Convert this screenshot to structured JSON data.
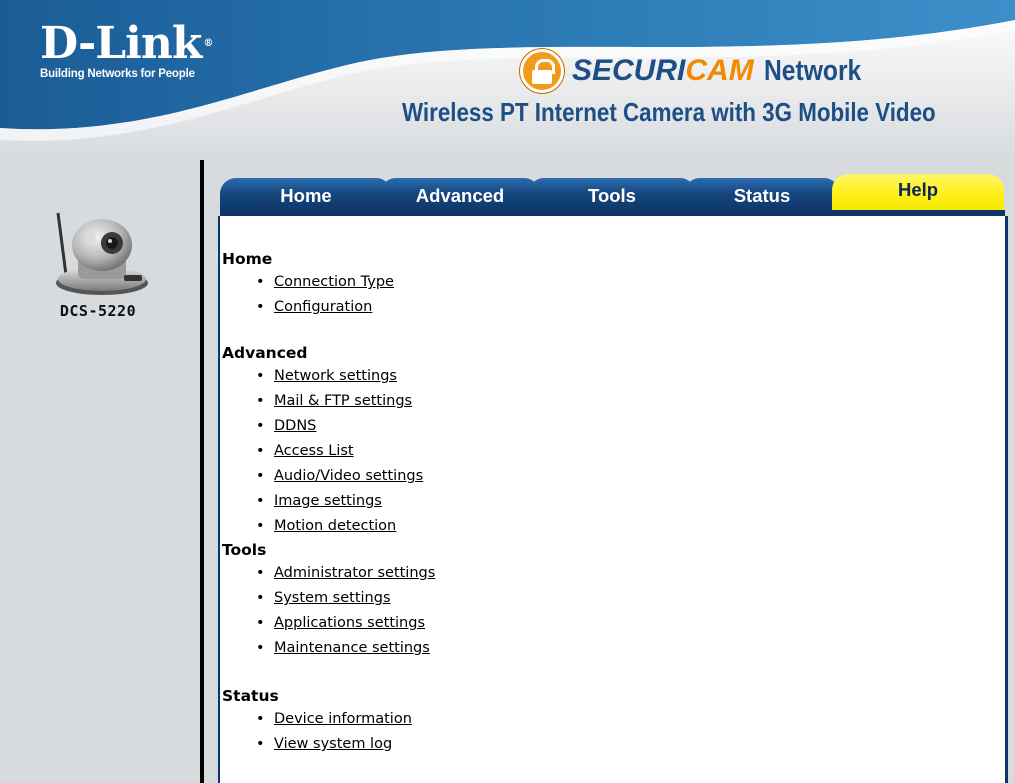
{
  "header": {
    "brand_logo": "D-Link",
    "brand_tagline": "Building Networks for People",
    "securicam_prefix": "SECURI",
    "securicam_suffix": "CAM",
    "securicam_network": "Network",
    "product_title": "Wireless PT Internet Camera with 3G Mobile Video",
    "colors": {
      "header_blue": "#1d4f86",
      "accent_orange": "#f18a00"
    }
  },
  "sidebar": {
    "model": "DCS-5220",
    "camera_icon": "camera-icon"
  },
  "tabs": [
    {
      "label": "Home",
      "active": false
    },
    {
      "label": "Advanced",
      "active": false
    },
    {
      "label": "Tools",
      "active": false
    },
    {
      "label": "Status",
      "active": false
    },
    {
      "label": "Help",
      "active": true
    }
  ],
  "sections": [
    {
      "title": "Home",
      "links": [
        "Connection Type",
        "Configuration"
      ]
    },
    {
      "title": "Advanced",
      "links": [
        "Network settings",
        "Mail & FTP settings",
        "DDNS",
        "Access List",
        "Audio/Video settings",
        "Image settings",
        "Motion detection"
      ]
    },
    {
      "title": "Tools",
      "links": [
        "Administrator settings",
        "System settings",
        "Applications settings",
        "Maintenance settings"
      ]
    },
    {
      "title": "Status",
      "links": [
        "Device information",
        "View system log"
      ]
    }
  ]
}
